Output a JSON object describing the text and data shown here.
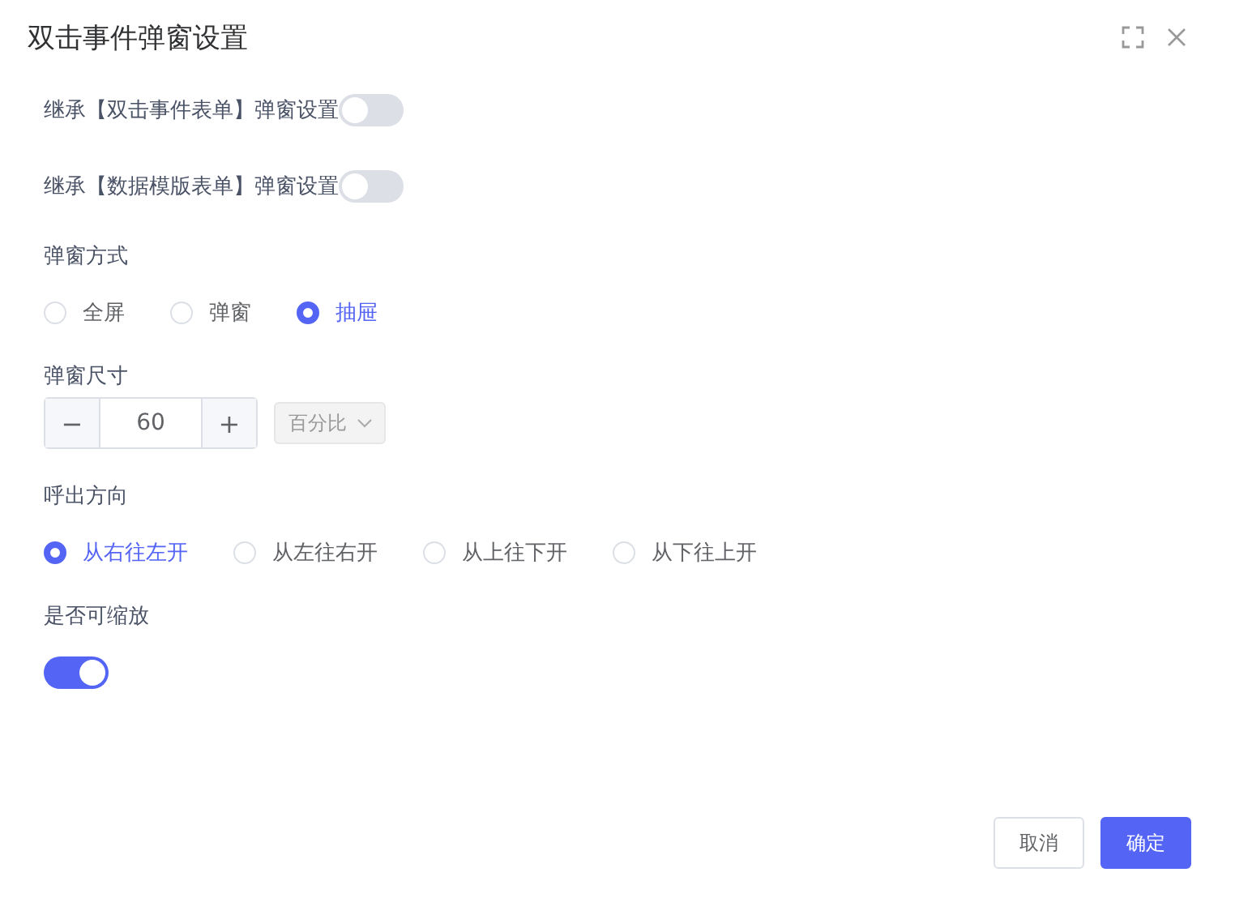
{
  "window": {
    "title": "双击事件弹窗设置"
  },
  "sections": [
    {
      "kind": "inline_toggle",
      "label": "继承【双击事件表单】弹窗设置",
      "on": false
    },
    {
      "kind": "inline_toggle",
      "label": "继承【数据模版表单】弹窗设置",
      "on": false
    },
    {
      "kind": "radio",
      "label": "弹窗方式",
      "options": [
        {
          "label": "全屏",
          "selected": false
        },
        {
          "label": "弹窗",
          "selected": false
        },
        {
          "label": "抽屉",
          "selected": true
        }
      ]
    },
    {
      "kind": "stepper",
      "label": "弹窗尺寸",
      "minus": "−",
      "value": "60",
      "plus": "+",
      "unit": "百分比"
    },
    {
      "kind": "radio",
      "label": "呼出方向",
      "options": [
        {
          "label": "从右往左开",
          "selected": true
        },
        {
          "label": "从左往右开",
          "selected": false
        },
        {
          "label": "从上往下开",
          "selected": false
        },
        {
          "label": "从下往上开",
          "selected": false
        }
      ]
    },
    {
      "kind": "toggle",
      "label": "是否可缩放",
      "on": true
    }
  ],
  "buttons": [
    {
      "label": "取消",
      "kind": "secondary"
    },
    {
      "label": "确定",
      "kind": "primary"
    }
  ]
}
